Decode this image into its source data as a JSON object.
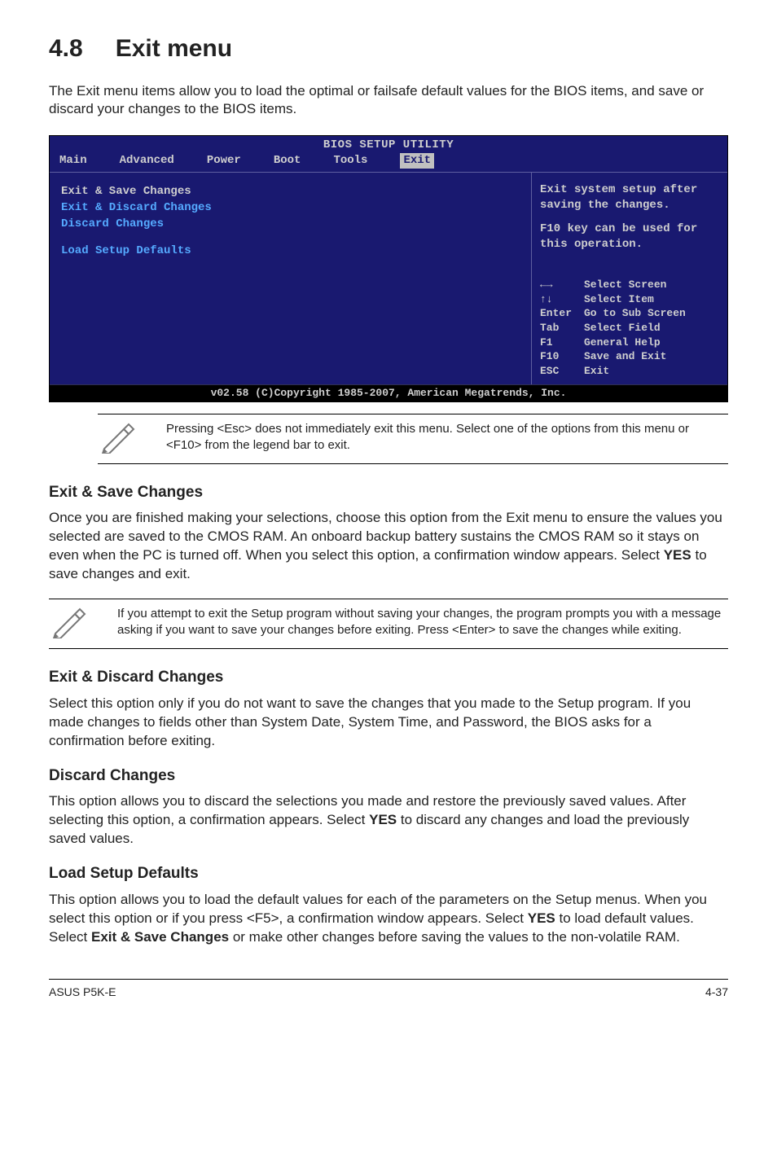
{
  "section": {
    "number": "4.8",
    "title": "Exit menu",
    "intro": "The Exit menu items allow you to load the optimal or failsafe default values for the BIOS items, and save or discard your changes to the BIOS items."
  },
  "bios": {
    "title": "BIOS SETUP UTILITY",
    "tabs": [
      "Main",
      "Advanced",
      "Power",
      "Boot",
      "Tools",
      "Exit"
    ],
    "active_tab_index": 5,
    "menu_items": [
      "Exit & Save Changes",
      "Exit & Discard Changes",
      "Discard Changes",
      "",
      "Load Setup Defaults"
    ],
    "help": {
      "line1": "Exit system setup after saving the changes.",
      "line2": "F10 key can be used for this operation."
    },
    "legend": [
      {
        "key": "←→",
        "action": "Select Screen"
      },
      {
        "key": "↑↓",
        "action": "Select Item"
      },
      {
        "key": "Enter",
        "action": "Go to Sub Screen"
      },
      {
        "key": "Tab",
        "action": "Select Field"
      },
      {
        "key": "F1",
        "action": "General Help"
      },
      {
        "key": "F10",
        "action": "Save and Exit"
      },
      {
        "key": "ESC",
        "action": "Exit"
      }
    ],
    "footer": "v02.58 (C)Copyright 1985-2007, American Megatrends, Inc."
  },
  "note1": "Pressing <Esc> does not immediately exit this menu. Select one of the options from this menu or <F10> from the legend bar to exit.",
  "sections": {
    "exit_save": {
      "heading": "Exit & Save Changes",
      "body_pre": "Once you are finished making your selections, choose this option from the Exit menu to ensure the values you selected are saved to the CMOS RAM. An onboard backup battery sustains the CMOS RAM so it stays on even when the PC is turned off. When you select this option, a confirmation window appears. Select ",
      "body_bold": "YES",
      "body_post": " to save changes and exit."
    },
    "note2": "If you attempt to exit the Setup program without saving your changes, the program prompts you with a message asking if you want to save your changes before exiting. Press <Enter> to save the changes while exiting.",
    "exit_discard": {
      "heading": "Exit & Discard Changes",
      "body": "Select this option only if you do not want to save the changes that you  made to the Setup program. If you made changes to fields other than System Date, System Time, and Password, the BIOS asks for a confirmation before exiting."
    },
    "discard": {
      "heading": "Discard Changes",
      "body_pre": "This option allows you to discard the selections you made and restore the previously saved values. After selecting this option, a confirmation appears. Select ",
      "body_bold": "YES",
      "body_post": " to discard any changes and load the previously saved values."
    },
    "load_defaults": {
      "heading": "Load Setup Defaults",
      "body_pre": "This option allows you to load the default values for each of the parameters on the Setup menus. When you select this option or if you press <F5>, a confirmation window appears. Select ",
      "body_bold1": "YES",
      "body_mid": " to load default values. Select ",
      "body_bold2": "Exit & Save Changes",
      "body_post": " or make other changes before saving the values to the non-volatile RAM."
    }
  },
  "footer": {
    "left": "ASUS P5K-E",
    "right": "4-37"
  }
}
